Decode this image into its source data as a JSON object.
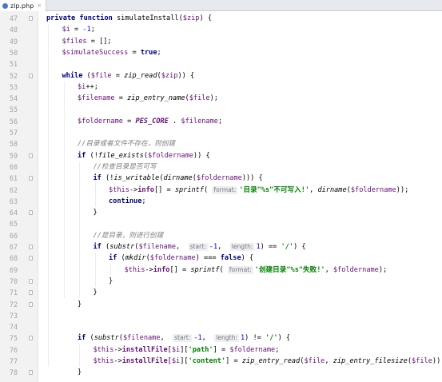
{
  "tab": {
    "title": "zip.php",
    "close": "×",
    "icon": "php-file-icon"
  },
  "colors": {
    "keyword": "#000080",
    "variable": "#660e7a",
    "string": "#008000",
    "comment": "#808080",
    "number": "#0000ff",
    "gutter": "#f2f2f2"
  },
  "lines": [
    {
      "n": "47",
      "fold": true,
      "indent": 0,
      "tokens": [
        [
          "kw",
          "private function "
        ],
        [
          "pl",
          "simulateInstall("
        ],
        [
          "var",
          "$zip"
        ],
        [
          "pl",
          ") {"
        ]
      ]
    },
    {
      "n": "48",
      "indent": 1,
      "tokens": [
        [
          "var",
          "$i"
        ],
        [
          "pl",
          " = "
        ],
        [
          "num",
          "-1"
        ],
        [
          "pl",
          ";"
        ]
      ]
    },
    {
      "n": "49",
      "indent": 1,
      "tokens": [
        [
          "var",
          "$files"
        ],
        [
          "pl",
          " = [];"
        ]
      ]
    },
    {
      "n": "50",
      "indent": 1,
      "tokens": [
        [
          "var",
          "$simulateSuccess"
        ],
        [
          "pl",
          " = "
        ],
        [
          "kw",
          "true"
        ],
        [
          "pl",
          ";"
        ]
      ]
    },
    {
      "n": "51",
      "indent": 0,
      "tokens": []
    },
    {
      "n": "52",
      "fold": true,
      "indent": 1,
      "tokens": [
        [
          "kw",
          "while "
        ],
        [
          "pl",
          "("
        ],
        [
          "var",
          "$file"
        ],
        [
          "pl",
          " = "
        ],
        [
          "fn",
          "zip_read"
        ],
        [
          "pl",
          "("
        ],
        [
          "var",
          "$zip"
        ],
        [
          "pl",
          ")) {"
        ]
      ]
    },
    {
      "n": "53",
      "indent": 2,
      "tokens": [
        [
          "var",
          "$i"
        ],
        [
          "pl",
          "++;"
        ]
      ]
    },
    {
      "n": "54",
      "indent": 2,
      "tokens": [
        [
          "var",
          "$filename"
        ],
        [
          "pl",
          " = "
        ],
        [
          "fn",
          "zip_entry_name"
        ],
        [
          "pl",
          "("
        ],
        [
          "var",
          "$file"
        ],
        [
          "pl",
          ");"
        ]
      ]
    },
    {
      "n": "55",
      "indent": 0,
      "tokens": []
    },
    {
      "n": "56",
      "indent": 2,
      "tokens": [
        [
          "var",
          "$foldername"
        ],
        [
          "pl",
          " = "
        ],
        [
          "cnst",
          "PES_CORE"
        ],
        [
          "pl",
          " . "
        ],
        [
          "var",
          "$filename"
        ],
        [
          "pl",
          ";"
        ]
      ]
    },
    {
      "n": "57",
      "indent": 0,
      "tokens": []
    },
    {
      "n": "58",
      "indent": 2,
      "tokens": [
        [
          "cmt",
          "//目录或者文件不存在，则创建"
        ]
      ]
    },
    {
      "n": "59",
      "fold": true,
      "indent": 2,
      "tokens": [
        [
          "kw",
          "if "
        ],
        [
          "pl",
          "(!"
        ],
        [
          "fn",
          "file_exists"
        ],
        [
          "pl",
          "("
        ],
        [
          "var",
          "$foldername"
        ],
        [
          "pl",
          ")) {"
        ]
      ]
    },
    {
      "n": "60",
      "indent": 3,
      "tokens": [
        [
          "cmt",
          "//检查目录是否可写"
        ]
      ]
    },
    {
      "n": "61",
      "fold": true,
      "indent": 3,
      "tokens": [
        [
          "kw",
          "if "
        ],
        [
          "pl",
          "(!"
        ],
        [
          "fn",
          "is_writable"
        ],
        [
          "pl",
          "("
        ],
        [
          "fn",
          "dirname"
        ],
        [
          "pl",
          "("
        ],
        [
          "var",
          "$foldername"
        ],
        [
          "pl",
          "))) {"
        ]
      ]
    },
    {
      "n": "62",
      "indent": 4,
      "tokens": [
        [
          "var",
          "$this"
        ],
        [
          "pl",
          "->"
        ],
        [
          "fld",
          "info"
        ],
        [
          "pl",
          "[] = "
        ],
        [
          "fn",
          "sprintf"
        ],
        [
          "pl",
          "( "
        ],
        [
          "hint",
          "format:"
        ],
        [
          "str",
          "'目录\"%s\"不可写入!'"
        ],
        [
          "pl",
          ", "
        ],
        [
          "fn",
          "dirname"
        ],
        [
          "pl",
          "("
        ],
        [
          "var",
          "$foldername"
        ],
        [
          "pl",
          "));"
        ]
      ]
    },
    {
      "n": "63",
      "indent": 4,
      "tokens": [
        [
          "kw",
          "continue"
        ],
        [
          "pl",
          ";"
        ]
      ]
    },
    {
      "n": "64",
      "fold": true,
      "indent": 3,
      "tokens": [
        [
          "pl",
          "}"
        ]
      ]
    },
    {
      "n": "65",
      "indent": 0,
      "tokens": []
    },
    {
      "n": "66",
      "indent": 3,
      "tokens": [
        [
          "cmt",
          "//是目录，则进行创建"
        ]
      ]
    },
    {
      "n": "67",
      "fold": true,
      "indent": 3,
      "tokens": [
        [
          "kw",
          "if "
        ],
        [
          "pl",
          "("
        ],
        [
          "fn",
          "substr"
        ],
        [
          "pl",
          "("
        ],
        [
          "var",
          "$filename"
        ],
        [
          "pl",
          ",  "
        ],
        [
          "hint",
          "start:"
        ],
        [
          "num",
          "-1"
        ],
        [
          "pl",
          ",  "
        ],
        [
          "hint",
          "length:"
        ],
        [
          "num",
          "1"
        ],
        [
          "pl",
          ") == "
        ],
        [
          "str",
          "'/'"
        ],
        [
          "pl",
          ") {"
        ]
      ]
    },
    {
      "n": "68",
      "fold": true,
      "indent": 4,
      "tokens": [
        [
          "kw",
          "if "
        ],
        [
          "pl",
          "("
        ],
        [
          "fn",
          "mkdir"
        ],
        [
          "pl",
          "("
        ],
        [
          "var",
          "$foldername"
        ],
        [
          "pl",
          ") === "
        ],
        [
          "kw",
          "false"
        ],
        [
          "pl",
          ") {"
        ]
      ]
    },
    {
      "n": "69",
      "indent": 5,
      "tokens": [
        [
          "var",
          "$this"
        ],
        [
          "pl",
          "->"
        ],
        [
          "fld",
          "info"
        ],
        [
          "pl",
          "[] = "
        ],
        [
          "fn",
          "sprintf"
        ],
        [
          "pl",
          "( "
        ],
        [
          "hint",
          "format:"
        ],
        [
          "str",
          "'创建目录\"%s\"失败!'"
        ],
        [
          "pl",
          ", "
        ],
        [
          "var",
          "$foldername"
        ],
        [
          "pl",
          ");"
        ]
      ]
    },
    {
      "n": "70",
      "fold": true,
      "indent": 4,
      "tokens": [
        [
          "pl",
          "}"
        ]
      ]
    },
    {
      "n": "71",
      "fold": true,
      "indent": 3,
      "tokens": [
        [
          "pl",
          "}"
        ]
      ]
    },
    {
      "n": "72",
      "fold": true,
      "indent": 2,
      "tokens": [
        [
          "pl",
          "}"
        ]
      ]
    },
    {
      "n": "73",
      "indent": 0,
      "tokens": []
    },
    {
      "n": "74",
      "indent": 0,
      "tokens": []
    },
    {
      "n": "75",
      "fold": true,
      "indent": 2,
      "tokens": [
        [
          "kw",
          "if "
        ],
        [
          "pl",
          "("
        ],
        [
          "fn",
          "substr"
        ],
        [
          "pl",
          "("
        ],
        [
          "var",
          "$filename"
        ],
        [
          "pl",
          ",  "
        ],
        [
          "hint",
          "start:"
        ],
        [
          "num",
          "-1"
        ],
        [
          "pl",
          ",  "
        ],
        [
          "hint",
          "length:"
        ],
        [
          "num",
          "1"
        ],
        [
          "pl",
          ") != "
        ],
        [
          "str",
          "'/'"
        ],
        [
          "pl",
          ") {"
        ]
      ]
    },
    {
      "n": "76",
      "indent": 3,
      "tokens": [
        [
          "var",
          "$this"
        ],
        [
          "pl",
          "->"
        ],
        [
          "fld",
          "installFile"
        ],
        [
          "pl",
          "["
        ],
        [
          "var",
          "$i"
        ],
        [
          "pl",
          "]["
        ],
        [
          "str",
          "'path'"
        ],
        [
          "pl",
          "] = "
        ],
        [
          "var",
          "$foldername"
        ],
        [
          "pl",
          ";"
        ]
      ]
    },
    {
      "n": "77",
      "indent": 3,
      "tokens": [
        [
          "var",
          "$this"
        ],
        [
          "pl",
          "->"
        ],
        [
          "fld",
          "installFile"
        ],
        [
          "pl",
          "["
        ],
        [
          "var",
          "$i"
        ],
        [
          "pl",
          "]["
        ],
        [
          "str",
          "'content'"
        ],
        [
          "pl",
          "] = "
        ],
        [
          "fn",
          "zip_entry_read"
        ],
        [
          "pl",
          "("
        ],
        [
          "var",
          "$file"
        ],
        [
          "pl",
          ", "
        ],
        [
          "fn",
          "zip_entry_filesize"
        ],
        [
          "pl",
          "("
        ],
        [
          "var",
          "$file"
        ],
        [
          "pl",
          "));"
        ]
      ]
    },
    {
      "n": "78",
      "fold": true,
      "indent": 2,
      "tokens": [
        [
          "pl",
          "}"
        ]
      ]
    }
  ]
}
